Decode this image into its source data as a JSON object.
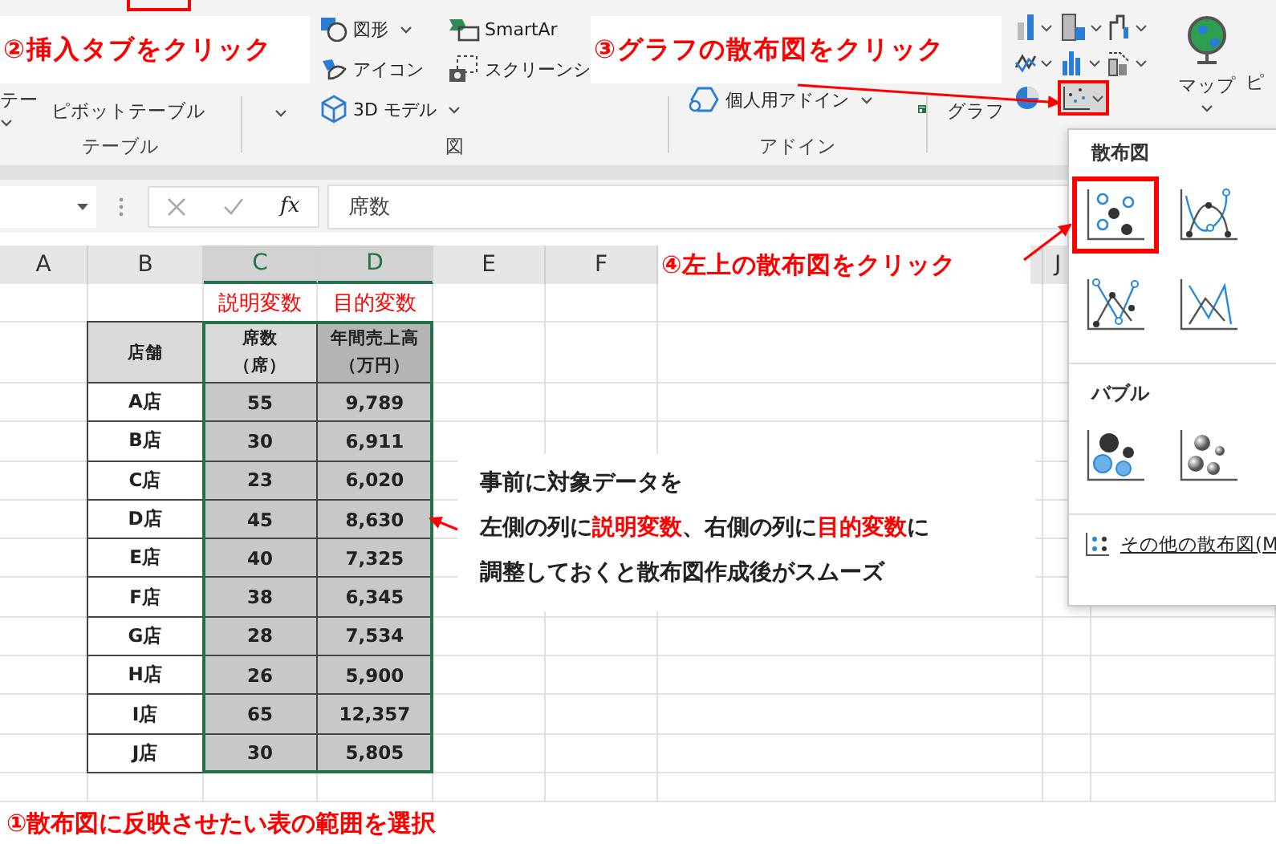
{
  "ribbon": {
    "table_group": {
      "label": "テーブル",
      "cut_button": "テー",
      "pivot": "ピボットテーブル"
    },
    "illustrations_group": {
      "label": "図",
      "shapes": "図形",
      "icons": "アイコン",
      "models": "3D モデル",
      "smartart": "SmartAr",
      "screenshot": "スクリーンシ"
    },
    "addins_group": {
      "label": "アドイン",
      "personal": "個人用アドイン"
    },
    "charts_group": {
      "recommended": "グラフ"
    },
    "maps": "マップ",
    "cut_right": "ピ"
  },
  "formula_bar": {
    "fx": "fx",
    "value": "席数"
  },
  "columns": [
    {
      "label": "A",
      "selected": false
    },
    {
      "label": "B",
      "selected": false
    },
    {
      "label": "C",
      "selected": true
    },
    {
      "label": "D",
      "selected": true
    },
    {
      "label": "E",
      "selected": false
    },
    {
      "label": "F",
      "selected": false
    },
    {
      "label": "J",
      "selected": false
    }
  ],
  "variable_labels": [
    "説明変数",
    "目的変数"
  ],
  "table": {
    "header": [
      {
        "lines": [
          "店舗"
        ]
      },
      {
        "lines": [
          "席数",
          "（席）"
        ]
      },
      {
        "lines": [
          "年間売上高",
          "（万円）"
        ]
      }
    ],
    "rows": [
      [
        "A店",
        "55",
        "9,789"
      ],
      [
        "B店",
        "30",
        "6,911"
      ],
      [
        "C店",
        "23",
        "6,020"
      ],
      [
        "D店",
        "45",
        "8,630"
      ],
      [
        "E店",
        "40",
        "7,325"
      ],
      [
        "F店",
        "38",
        "6,345"
      ],
      [
        "G店",
        "28",
        "7,534"
      ],
      [
        "H店",
        "26",
        "5,900"
      ],
      [
        "I店",
        "65",
        "12,357"
      ],
      [
        "J店",
        "30",
        "5,805"
      ]
    ]
  },
  "annotations": {
    "step2": "②挿入タブをクリック",
    "step3": "③グラフの散布図をクリック",
    "step4": "④左上の散布図をクリック",
    "step1": "①散布図に反映させたい表の範囲を選択",
    "note": [
      [
        {
          "text": "事前に対象データを",
          "highlight": false
        }
      ],
      [
        {
          "text": "左側の列に",
          "highlight": false
        },
        {
          "text": "説明変数",
          "highlight": true
        },
        {
          "text": "、右側の列に",
          "highlight": false
        },
        {
          "text": "目的変数",
          "highlight": true
        },
        {
          "text": "に",
          "highlight": false
        }
      ],
      [
        {
          "text": "調整しておくと散布図作成後がスムーズ",
          "highlight": false
        }
      ]
    ]
  },
  "dropdown": {
    "scatter_heading": "散布図",
    "scatter_types": [
      {
        "kind": "markers",
        "highlighted": true
      },
      {
        "kind": "smooth",
        "highlighted": false
      },
      {
        "kind": "straight-markers",
        "highlighted": false
      },
      {
        "kind": "straight",
        "highlighted": false
      }
    ],
    "bubble_heading": "バブル",
    "bubble_types": [
      {
        "kind": "flat"
      },
      {
        "kind": "shaded"
      }
    ],
    "more": "その他の散布図(M"
  }
}
